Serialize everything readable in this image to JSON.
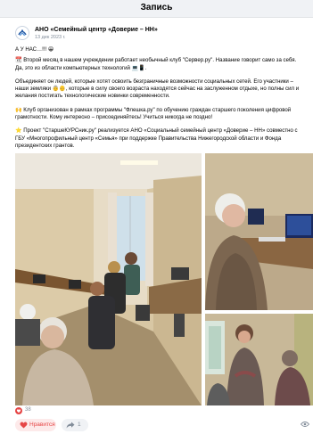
{
  "page": {
    "title": "Запись"
  },
  "post": {
    "author": "АНО «Семейный центр «Доверие – НН»",
    "date": "13 дек 2023 г.",
    "paragraphs": [
      "А У НАС…!!! 😀",
      "📆 Второй месяц в нашем учреждении работает необычный клуб \"Сервер.ру\". Название говорит само за себя. Да, это из области компьютерных технологий 💻📱.",
      "Объединяет он людей, которые хотят освоить безграничные возможности социальных сетей. Его участники – наши земляки 👵👴, которые в силу своего возраста находятся сейчас на заслуженном отдыхе, но полны сил и желания постигать технологические новинки современности.",
      "🙌 Клуб организован в рамках программы \"Флешка.ру\" по обучению граждан старшего поколения цифровой грамотности. Кому интересно – присоединяйтесь! Учиться никогда не поздно!",
      "⭐ Проект \"СтаршеКУРСник.ру\" реализуется АНО «Социальный семейный центр «Доверие – НН» совместно с ГБУ «Многопрофильный центр «Семья» при поддержке Правительства Нижегородской области и Фонда президентских грантов."
    ]
  },
  "footer": {
    "likes_count": "38",
    "like_label": "Нравится",
    "share_count": "1"
  },
  "colors": {
    "accent": "#e64646",
    "muted": "#818c99",
    "topbar": "#f0f2f5"
  },
  "icons": [
    "logo-icon",
    "heart-icon",
    "share-icon",
    "eye-icon"
  ]
}
